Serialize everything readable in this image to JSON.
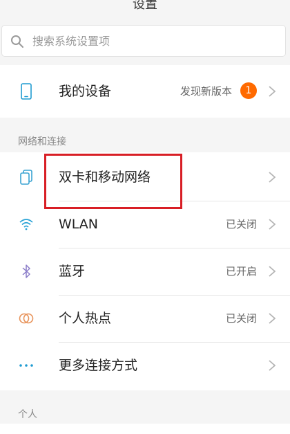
{
  "header": {
    "title": "设置"
  },
  "search": {
    "placeholder": "搜索系统设置项"
  },
  "device": {
    "label": "我的设备",
    "status": "发现新版本",
    "badge": "1"
  },
  "network": {
    "section_title": "网络和连接",
    "items": [
      {
        "label": "双卡和移动网络",
        "status": ""
      },
      {
        "label": "WLAN",
        "status": "已关闭"
      },
      {
        "label": "蓝牙",
        "status": "已开启"
      },
      {
        "label": "个人热点",
        "status": "已关闭"
      },
      {
        "label": "更多连接方式",
        "status": ""
      }
    ]
  },
  "personal": {
    "section_title": "个人"
  },
  "colors": {
    "accent_badge": "#ff6a00",
    "highlight_box": "#d81e25",
    "wlan_icon": "#29a3d6",
    "bluetooth_icon": "#8a7cc9",
    "hotspot_icon": "#e8935a",
    "more_icon": "#1f9bd1"
  }
}
